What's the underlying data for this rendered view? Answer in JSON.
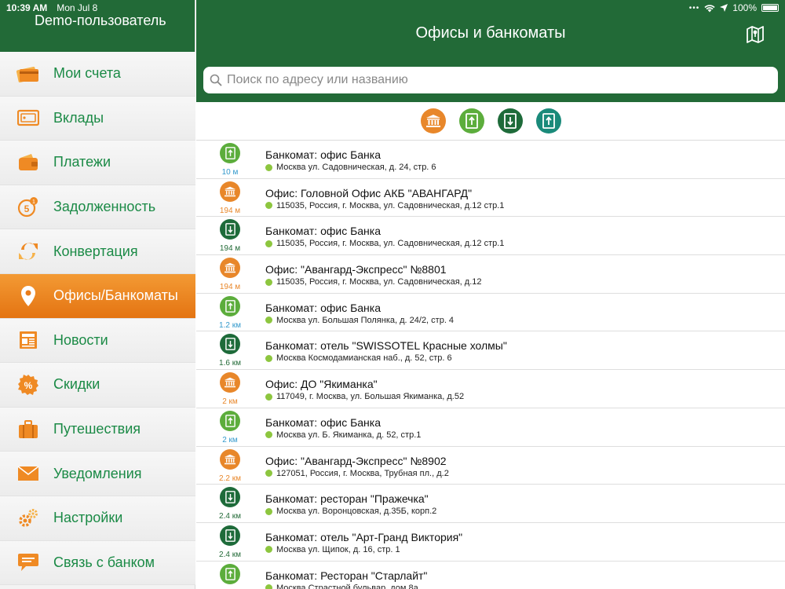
{
  "status": {
    "time": "10:39 AM",
    "date": "Mon Jul 8",
    "battery": "100%"
  },
  "sidebar": {
    "user": "Demo-пользователь",
    "items": [
      {
        "label": "Мои счета",
        "icon": "card-icon",
        "active": false
      },
      {
        "label": "Вклады",
        "icon": "deposit-icon",
        "active": false
      },
      {
        "label": "Платежи",
        "icon": "wallet-icon",
        "active": false
      },
      {
        "label": "Задолженность",
        "icon": "debt-icon",
        "active": false
      },
      {
        "label": "Конвертация",
        "icon": "exchange-icon",
        "active": false
      },
      {
        "label": "Офисы/Банкоматы",
        "icon": "location-pin-icon",
        "active": true
      },
      {
        "label": "Новости",
        "icon": "news-icon",
        "active": false
      },
      {
        "label": "Скидки",
        "icon": "discount-icon",
        "active": false
      },
      {
        "label": "Путешествия",
        "icon": "suitcase-icon",
        "active": false
      },
      {
        "label": "Уведомления",
        "icon": "envelope-icon",
        "active": false
      },
      {
        "label": "Настройки",
        "icon": "gear-icon",
        "active": false
      },
      {
        "label": "Связь с банком",
        "icon": "chat-icon",
        "active": false
      }
    ]
  },
  "header": {
    "title": "Офисы и банкоматы"
  },
  "search": {
    "placeholder": "Поиск по адресу или названию"
  },
  "colors": {
    "brand_green": "#226a37",
    "accent_orange": "#ef8a24",
    "office_orange": "#e8872a",
    "atm_in_green": "#5cad3c",
    "atm_out_dark": "#1e6b3a",
    "atm_teal": "#1a8a7a",
    "dist_blue": "#3399cc"
  },
  "filters": [
    {
      "icon": "bank-building-icon",
      "color": "#e8872a"
    },
    {
      "icon": "atm-deposit-icon",
      "color": "#5cad3c"
    },
    {
      "icon": "atm-withdraw-icon",
      "color": "#1e6b3a"
    },
    {
      "icon": "atm-transfer-icon",
      "color": "#1a8a7a"
    }
  ],
  "locations": [
    {
      "type": "atm-in",
      "distance": "10 м",
      "title": "Банкомат: офис Банка",
      "address": "Москва ул. Садовническая, д. 24, стр. 6"
    },
    {
      "type": "office",
      "distance": "194 м",
      "title": "Офис: Головной Офис АКБ \"АВАНГАРД\"",
      "address": "115035, Россия, г. Москва, ул. Садовническая, д.12 стр.1"
    },
    {
      "type": "atm-out",
      "distance": "194 м",
      "title": "Банкомат: офис Банка",
      "address": "115035, Россия, г. Москва, ул. Садовническая, д.12 стр.1"
    },
    {
      "type": "office",
      "distance": "194 м",
      "title": "Офис: \"Авангард-Экспресс\" №8801",
      "address": "115035, Россия, г. Москва, ул. Садовническая, д.12"
    },
    {
      "type": "atm-in",
      "distance": "1.2 км",
      "title": "Банкомат: офис Банка",
      "address": "Москва ул. Большая Полянка, д. 24/2, стр. 4"
    },
    {
      "type": "atm-out",
      "distance": "1.6 км",
      "title": "Банкомат: отель \"SWISSOTEL Красные холмы\"",
      "address": "Москва Космодамианская наб., д. 52, стр. 6"
    },
    {
      "type": "office",
      "distance": "2 км",
      "title": "Офис: ДО \"Якиманка\"",
      "address": "117049, г. Москва, ул. Большая Якиманка, д.52"
    },
    {
      "type": "atm-in",
      "distance": "2 км",
      "title": "Банкомат: офис Банка",
      "address": "Москва ул. Б. Якиманка, д. 52, стр.1"
    },
    {
      "type": "office",
      "distance": "2.2 км",
      "title": "Офис: \"Авангард-Экспресс\" №8902",
      "address": "127051, Россия, г. Москва, Трубная пл., д.2"
    },
    {
      "type": "atm-out",
      "distance": "2.4 км",
      "title": "Банкомат: ресторан \"Пражечка\"",
      "address": "Москва ул. Воронцовская, д.35Б, корп.2"
    },
    {
      "type": "atm-out",
      "distance": "2.4 км",
      "title": "Банкомат: отель \"Арт-Гранд Виктория\"",
      "address": "Москва ул. Щипок, д. 16, стр. 1"
    },
    {
      "type": "atm-in",
      "distance": "",
      "title": "Банкомат: Ресторан \"Старлайт\"",
      "address": "Москва Страстной бульвар, дом 8а"
    }
  ]
}
